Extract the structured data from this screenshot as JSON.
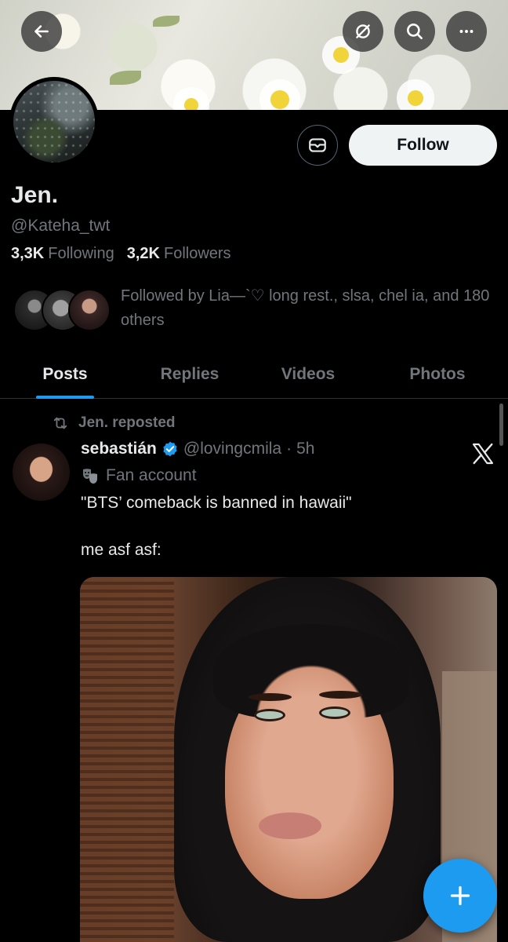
{
  "profile": {
    "name": "Jen.",
    "handle": "@Kateha_twt",
    "following_count": "3,3K",
    "following_label": "Following",
    "followers_count": "3,2K",
    "followers_label": "Followers",
    "followed_by": "Followed by Lia—`♡ long rest., slsa, chel ia, and 180 others"
  },
  "actions": {
    "follow_label": "Follow"
  },
  "header_icons": [
    "back-arrow-icon",
    "grok-icon",
    "search-icon",
    "more-icon"
  ],
  "tabs": [
    {
      "label": "Posts",
      "active": true
    },
    {
      "label": "Replies",
      "active": false
    },
    {
      "label": "Videos",
      "active": false
    },
    {
      "label": "Photos",
      "active": false
    }
  ],
  "post": {
    "repost_label": "Jen. reposted",
    "author_name": "sebastián",
    "author_handle": "@lovingcmila",
    "separator": "·",
    "time": "5h",
    "label": "Fan account",
    "text": "\"BTS’ comeback is banned in hawaii\"\n\nme asf asf:"
  },
  "colors": {
    "accent": "#1d9bf0",
    "background": "#000000",
    "muted_text": "#71767b"
  }
}
